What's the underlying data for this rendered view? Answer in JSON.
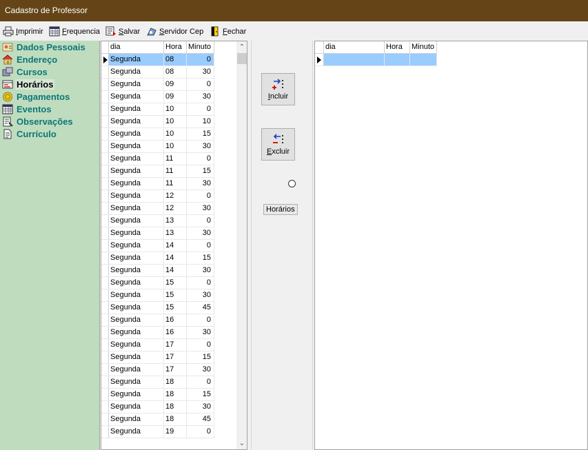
{
  "window": {
    "title": "Cadastro de Professor"
  },
  "toolbar": {
    "imprimir": {
      "pre": "",
      "ul": "I",
      "post": "mprimir"
    },
    "frequencia": {
      "pre": "",
      "ul": "F",
      "post": "requencia"
    },
    "salvar": {
      "pre": "",
      "ul": "S",
      "post": "alvar"
    },
    "servidor": {
      "pre": "",
      "ul": "S",
      "post": "ervidor Cep"
    },
    "fechar": {
      "pre": "",
      "ul": "F",
      "post": "echar"
    }
  },
  "sidebar": {
    "items": [
      {
        "label": "Dados Pessoais"
      },
      {
        "label": "Endereço"
      },
      {
        "label": "Cursos"
      },
      {
        "label": "Horários"
      },
      {
        "label": "Pagamentos"
      },
      {
        "label": "Eventos"
      },
      {
        "label": "Observações"
      },
      {
        "label": "Currículo"
      }
    ]
  },
  "grid1": {
    "headers": [
      "dia",
      "Hora",
      "Minuto"
    ],
    "rows": [
      [
        "Segunda",
        "08",
        "0"
      ],
      [
        "Segunda",
        "08",
        "30"
      ],
      [
        "Segunda",
        "09",
        "0"
      ],
      [
        "Segunda",
        "09",
        "30"
      ],
      [
        "Segunda",
        "10",
        "0"
      ],
      [
        "Segunda",
        "10",
        "10"
      ],
      [
        "Segunda",
        "10",
        "15"
      ],
      [
        "Segunda",
        "10",
        "30"
      ],
      [
        "Segunda",
        "11",
        "0"
      ],
      [
        "Segunda",
        "11",
        "15"
      ],
      [
        "Segunda",
        "11",
        "30"
      ],
      [
        "Segunda",
        "12",
        "0"
      ],
      [
        "Segunda",
        "12",
        "30"
      ],
      [
        "Segunda",
        "13",
        "0"
      ],
      [
        "Segunda",
        "13",
        "30"
      ],
      [
        "Segunda",
        "14",
        "0"
      ],
      [
        "Segunda",
        "14",
        "15"
      ],
      [
        "Segunda",
        "14",
        "30"
      ],
      [
        "Segunda",
        "15",
        "0"
      ],
      [
        "Segunda",
        "15",
        "30"
      ],
      [
        "Segunda",
        "15",
        "45"
      ],
      [
        "Segunda",
        "16",
        "0"
      ],
      [
        "Segunda",
        "16",
        "30"
      ],
      [
        "Segunda",
        "17",
        "0"
      ],
      [
        "Segunda",
        "17",
        "15"
      ],
      [
        "Segunda",
        "17",
        "30"
      ],
      [
        "Segunda",
        "18",
        "0"
      ],
      [
        "Segunda",
        "18",
        "15"
      ],
      [
        "Segunda",
        "18",
        "30"
      ],
      [
        "Segunda",
        "18",
        "45"
      ],
      [
        "Segunda",
        "19",
        "0"
      ]
    ]
  },
  "middle": {
    "incluir": {
      "pre": "",
      "ul": "I",
      "post": "ncluir"
    },
    "excluir": {
      "pre": "",
      "ul": "E",
      "post": "xcluir"
    },
    "tag": "Horários"
  },
  "grid2": {
    "headers": [
      "dia",
      "Hora",
      "Minuto"
    ],
    "rows": [
      [
        "",
        "",
        ""
      ]
    ]
  },
  "colors": {
    "titlebar": "#654517",
    "sidebar": "#bfdcbf",
    "nav_text": "#0b7777",
    "selection": "#99ccff"
  }
}
